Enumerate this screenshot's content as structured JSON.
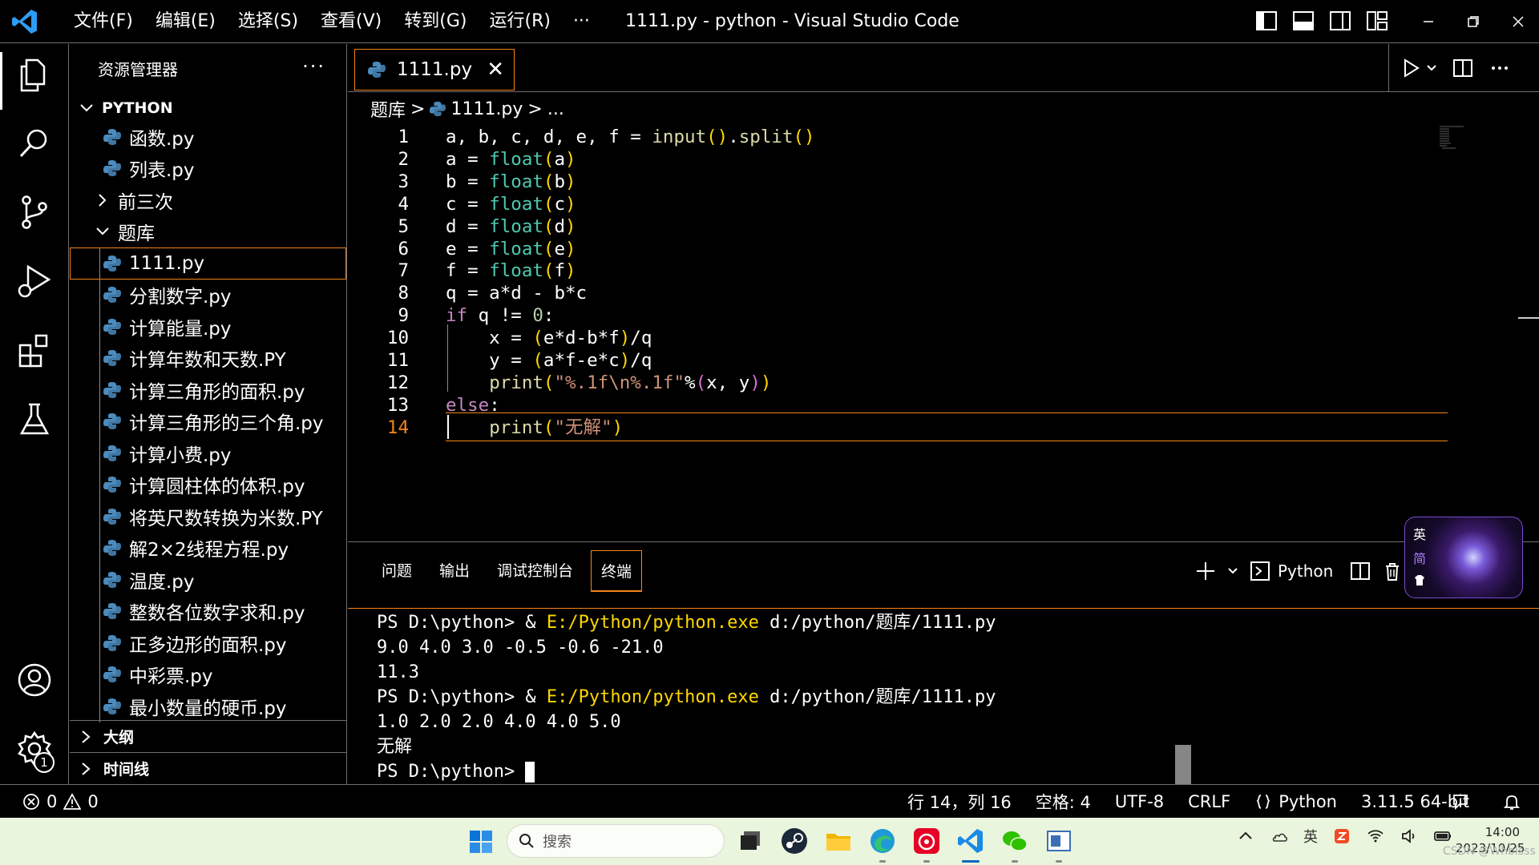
{
  "window": {
    "title": "1111.py - python - Visual Studio Code",
    "menu": [
      "文件(F)",
      "编辑(E)",
      "选择(S)",
      "查看(V)",
      "转到(G)",
      "运行(R)",
      "···"
    ]
  },
  "sidebar": {
    "title": "资源管理器",
    "more": "···",
    "root": "PYTHON",
    "items": [
      {
        "label": "函数.py",
        "kind": "file",
        "level": 1
      },
      {
        "label": "列表.py",
        "kind": "file",
        "level": 1
      },
      {
        "label": "前三次",
        "kind": "folder-collapsed",
        "level": 1
      },
      {
        "label": "题库",
        "kind": "folder-expanded",
        "level": 1
      },
      {
        "label": "1111.py",
        "kind": "file",
        "level": 2,
        "selected": true
      },
      {
        "label": "分割数字.py",
        "kind": "file",
        "level": 2
      },
      {
        "label": "计算能量.py",
        "kind": "file",
        "level": 2
      },
      {
        "label": "计算年数和天数.PY",
        "kind": "file",
        "level": 2
      },
      {
        "label": "计算三角形的面积.py",
        "kind": "file",
        "level": 2
      },
      {
        "label": "计算三角形的三个角.py",
        "kind": "file",
        "level": 2
      },
      {
        "label": "计算小费.py",
        "kind": "file",
        "level": 2
      },
      {
        "label": "计算圆柱体的体积.py",
        "kind": "file",
        "level": 2
      },
      {
        "label": "将英尺数转换为米数.PY",
        "kind": "file",
        "level": 2
      },
      {
        "label": "解2×2线程方程.py",
        "kind": "file",
        "level": 2
      },
      {
        "label": "温度.py",
        "kind": "file",
        "level": 2
      },
      {
        "label": "整数各位数字求和.py",
        "kind": "file",
        "level": 2
      },
      {
        "label": "正多边形的面积.py",
        "kind": "file",
        "level": 2
      },
      {
        "label": "中彩票.py",
        "kind": "file",
        "level": 2
      },
      {
        "label": "最小数量的硬币.py",
        "kind": "file",
        "level": 2
      }
    ],
    "outline": "大纲",
    "timeline": "时间线",
    "settings_badge": "1"
  },
  "editor": {
    "tab_label": "1111.py",
    "tab_close": "✕",
    "breadcrumb": [
      "题库",
      ">",
      "1111.py",
      ">",
      "..."
    ],
    "current_line": 14,
    "lines": [
      "a, b, c, d, e, f = input().split()",
      "a = float(a)",
      "b = float(b)",
      "c = float(c)",
      "d = float(d)",
      "e = float(e)",
      "f = float(f)",
      "q = a*d - b*c",
      "if q != 0:",
      "    x = (e*d-b*f)/q",
      "    y = (a*f-e*c)/q",
      "    print(\"%.1f\\n%.1f\"%(x, y))",
      "else:",
      "    print(\"无解\")"
    ]
  },
  "panel": {
    "tabs": [
      "问题",
      "输出",
      "调试控制台",
      "终端"
    ],
    "active_tab": "终端",
    "shell_label": "Python",
    "terminal": [
      {
        "prompt": "PS D:\\python> & ",
        "exe": "E:/Python/python.exe",
        "rest": " d:/python/题库/1111.py"
      },
      {
        "text": "9.0 4.0 3.0 -0.5 -0.6 -21.0"
      },
      {
        "text": "11.3"
      },
      {
        "prompt": "PS D:\\python> & ",
        "exe": "E:/Python/python.exe",
        "rest": " d:/python/题库/1111.py"
      },
      {
        "text": "1.0 2.0 2.0 4.0 4.0 5.0"
      },
      {
        "text": "无解"
      },
      {
        "text": "PS D:\\python> "
      }
    ]
  },
  "ime": {
    "lang": "英",
    "mode": "简"
  },
  "statusbar": {
    "errors": "0",
    "warnings": "0",
    "position": "行 14，列 16",
    "spaces": "空格: 4",
    "encoding": "UTF-8",
    "eol": "CRLF",
    "language": "Python",
    "interpreter": "3.11.5 64-bit"
  },
  "taskbar": {
    "search_placeholder": "搜索",
    "tray_ime": "英",
    "time": "14:00",
    "date": "2023/10/25"
  },
  "watermark": "CSDN @Whblsss",
  "colors": {
    "accent": "#f38518",
    "keyword": "#c586c0",
    "function": "#dcdcaa",
    "builtin": "#4ec9b0",
    "string": "#ce9178",
    "number": "#b5cea8",
    "python_icon": "#4b8bbe",
    "taskbar_bg": "#e9f5dc"
  }
}
